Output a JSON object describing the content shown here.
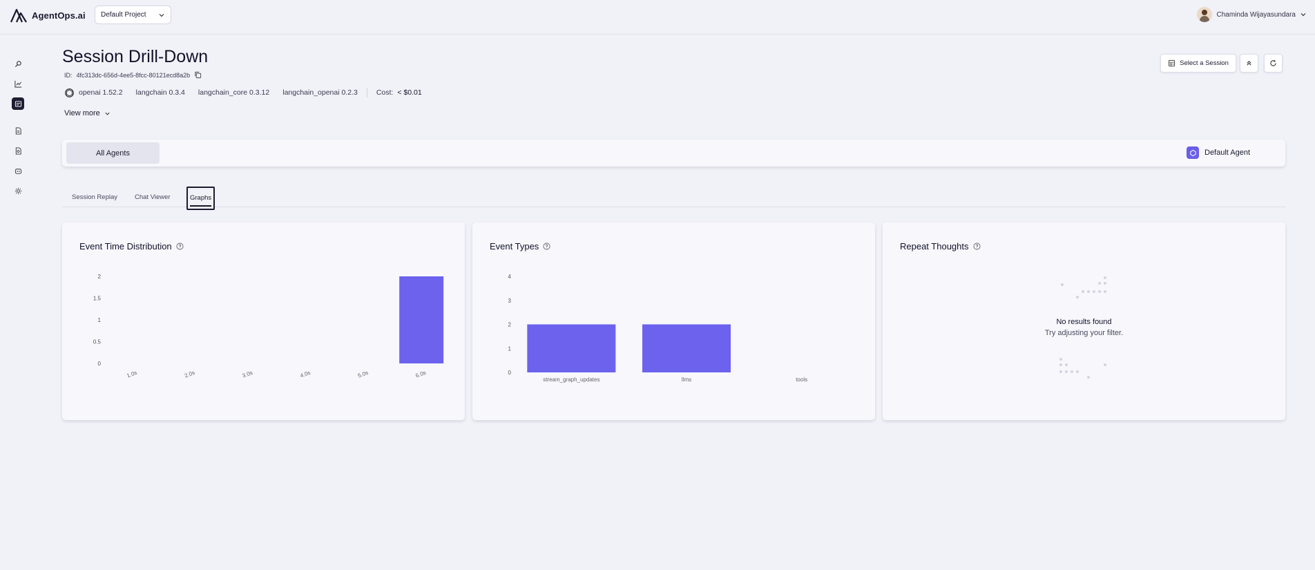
{
  "app": {
    "logo_text": "AgentOps.ai",
    "project": "Default Project",
    "user_name": "Chaminda Wijayasundara"
  },
  "sidebar": {
    "items": [
      {
        "icon": "search-icon"
      },
      {
        "icon": "chart-line-icon"
      },
      {
        "icon": "sessions-icon",
        "active": true
      },
      {
        "icon": "document-icon"
      },
      {
        "icon": "document-search-icon"
      },
      {
        "icon": "robot-icon"
      },
      {
        "icon": "gear-icon"
      }
    ]
  },
  "header": {
    "title": "Session Drill-Down",
    "id_label": "ID:",
    "id_value": "4fc313dc-656d-4ee5-8fcc-80121ecd8a2b",
    "packages": [
      "openai 1.52.2",
      "langchain 0.3.4",
      "langchain_core 0.3.12",
      "langchain_openai 0.2.3"
    ],
    "cost_label": "Cost:",
    "cost_value": "< $0.01",
    "view_more": "View more",
    "select_session": "Select a Session"
  },
  "agents": {
    "all": "All Agents",
    "default": "Default Agent"
  },
  "tabs": [
    {
      "label": "Session Replay"
    },
    {
      "label": "Chat Viewer"
    },
    {
      "label": "Graphs",
      "active": true
    }
  ],
  "colors": {
    "bar": "#6c62ee",
    "accent": "#6a5ee8",
    "background": "#f1f1f8"
  },
  "cards": {
    "time_dist_title": "Event Time Distribution",
    "event_types_title": "Event Types",
    "repeat_title": "Repeat Thoughts",
    "empty_title": "No results found",
    "empty_sub": "Try adjusting your filter."
  },
  "chart_data": [
    {
      "type": "bar",
      "title": "Event Time Distribution",
      "categories": [
        "1.0s",
        "2.0s",
        "3.0s",
        "4.0s",
        "5.0s",
        "6.0s"
      ],
      "values": [
        0,
        0,
        0,
        0,
        0,
        2
      ],
      "yticks": [
        "0",
        "0.5",
        "1",
        "1.5",
        "2"
      ],
      "ylim": [
        0,
        2
      ]
    },
    {
      "type": "bar",
      "title": "Event Types",
      "categories": [
        "stream_graph_updates",
        "llms",
        "tools"
      ],
      "values": [
        2,
        2,
        0
      ],
      "yticks": [
        "0",
        "1",
        "2",
        "3",
        "4"
      ],
      "ylim": [
        0,
        4
      ]
    }
  ]
}
